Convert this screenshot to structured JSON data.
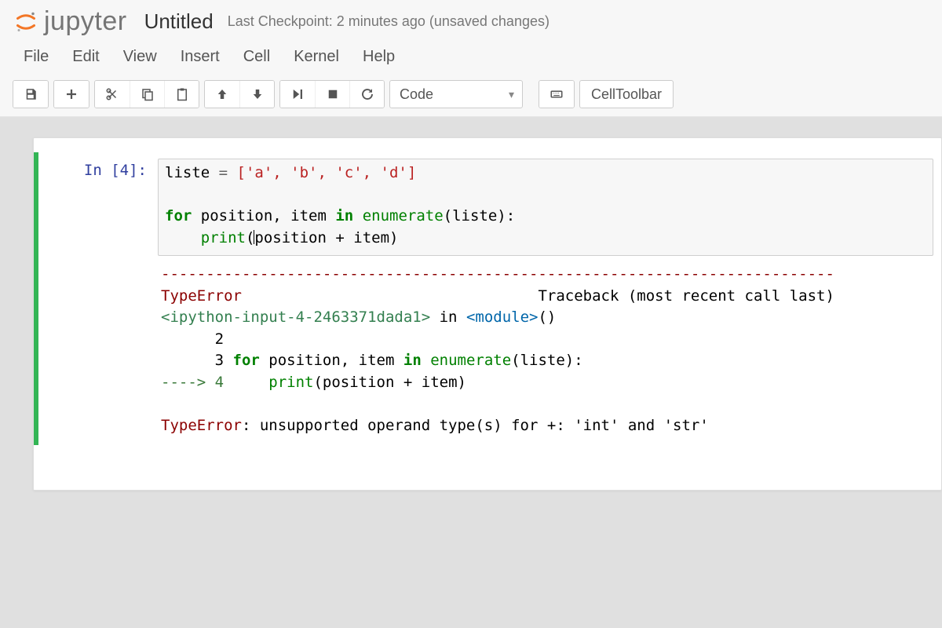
{
  "header": {
    "brand": "jupyter",
    "doc_title": "Untitled",
    "checkpoint": "Last Checkpoint: 2 minutes ago (unsaved changes)"
  },
  "menubar": [
    "File",
    "Edit",
    "View",
    "Insert",
    "Cell",
    "Kernel",
    "Help"
  ],
  "toolbar": {
    "cell_type": "Code",
    "cell_toolbar_label": "CellToolbar"
  },
  "cell": {
    "prompt_prefix": "In [",
    "prompt_number": "4",
    "prompt_suffix": "]:",
    "code_line1_var": "liste",
    "code_line1_eq": " = ",
    "code_line1_list": "['a', 'b', 'c', 'd']",
    "code_line3_for": "for",
    "code_line3_vars": " position, item ",
    "code_line3_in": "in",
    "code_line3_enum": " enumerate",
    "code_line3_paren": "(liste):",
    "code_line4_indent": "    ",
    "code_line4_print": "print",
    "code_line4_open": "(",
    "code_line4_expr": "position + item",
    "code_line4_close": ")"
  },
  "output": {
    "separator": "---------------------------------------------------------------------------",
    "err_name": "TypeError",
    "traceback_label": "Traceback (most recent call last)",
    "frame_loc_pre": "<ipython-input-4-2463371dada1>",
    "frame_in": " in ",
    "frame_module": "<module>",
    "frame_parens": "()",
    "line2": "      2 ",
    "line3_num": "      3 ",
    "line3_for": "for",
    "line3_vars": " position, item ",
    "line3_in": "in",
    "line3_enum": " enumerate",
    "line3_rest": "(liste):",
    "line4_arrow": "----> 4     ",
    "line4_print": "print",
    "line4_rest": "(position + item)",
    "err_final_name": "TypeError",
    "err_final_msg": ": unsupported operand type(s) for +: 'int' and 'str'"
  }
}
